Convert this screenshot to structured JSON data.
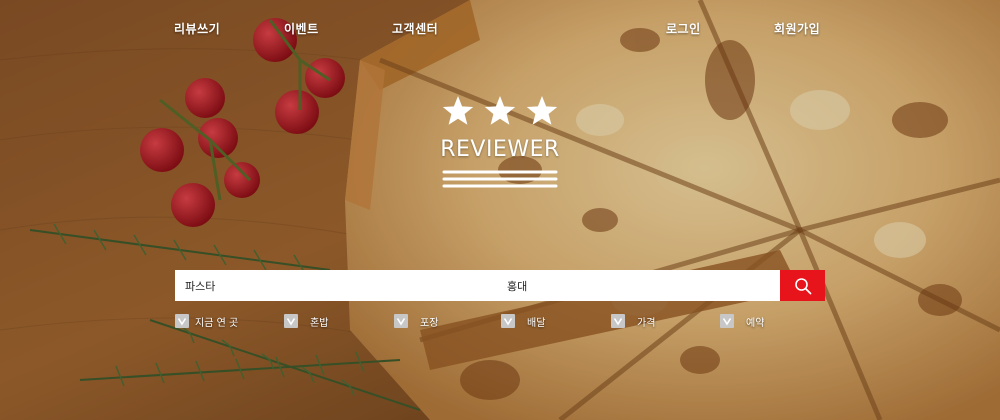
{
  "nav": {
    "links": [
      {
        "label": "리뷰쓰기"
      },
      {
        "label": "이벤트"
      },
      {
        "label": "고객센터"
      },
      {
        "label": "로그인"
      },
      {
        "label": "회원가입"
      }
    ]
  },
  "logo": {
    "text": "REVIEWER",
    "star_count": 3
  },
  "search": {
    "what_value": "파스타",
    "where_value": "홍대",
    "button_icon": "search-icon"
  },
  "filters": [
    {
      "label": "지금 연 곳",
      "checked": true
    },
    {
      "label": "혼밥",
      "checked": true
    },
    {
      "label": "포장",
      "checked": true
    },
    {
      "label": "배달",
      "checked": true
    },
    {
      "label": "가격",
      "checked": true
    },
    {
      "label": "예약",
      "checked": true
    }
  ],
  "colors": {
    "accent": "#e8141c",
    "checkbox": "#c7c7c7",
    "text_light": "#ffffff"
  }
}
